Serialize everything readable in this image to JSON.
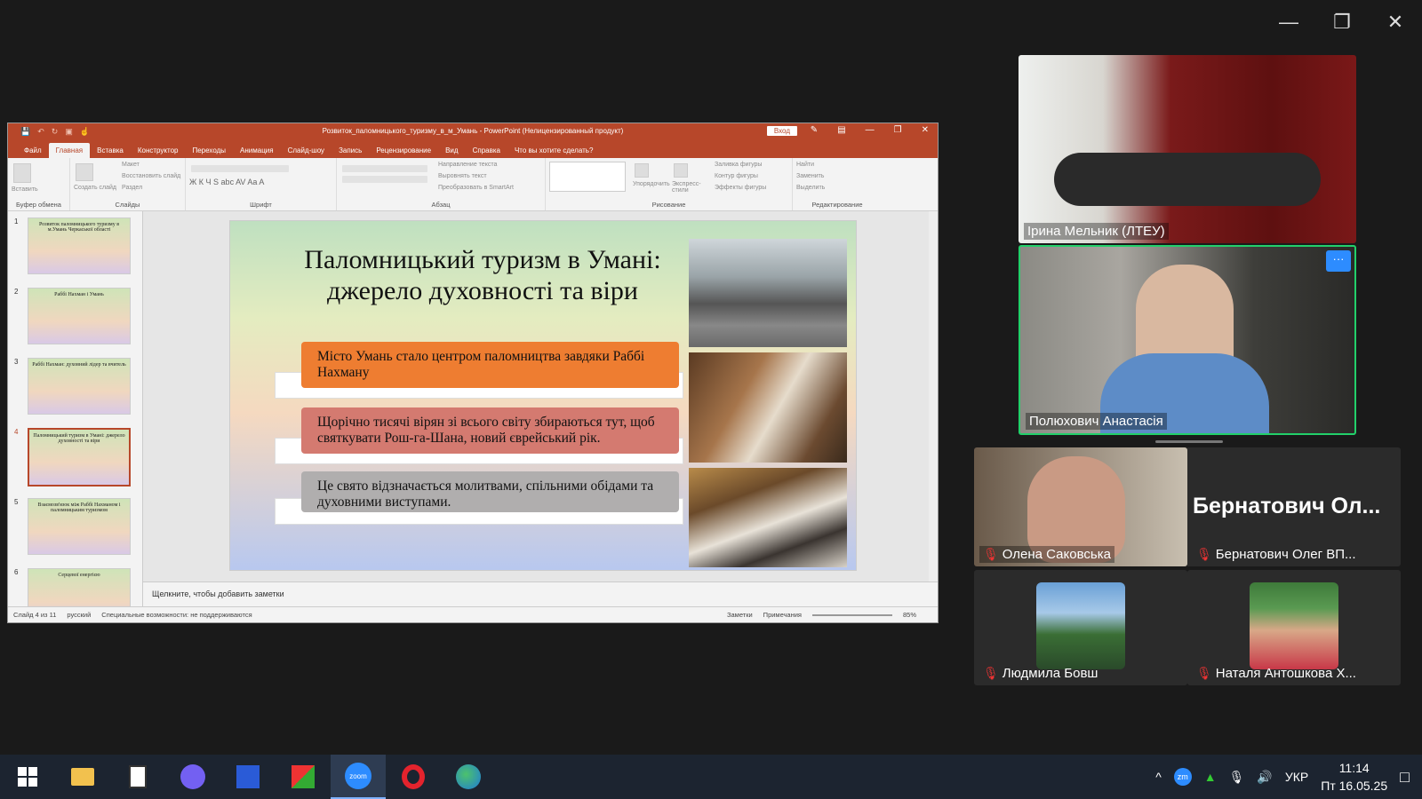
{
  "zoom_window": {
    "controls": [
      "minimize",
      "restore",
      "close"
    ]
  },
  "ppt": {
    "doc_title": "Розвиток_паломницького_туризму_в_м_Умань - PowerPoint (Нелицензированный продукт)",
    "signin": "Вход",
    "tabs": [
      "Файл",
      "Главная",
      "Вставка",
      "Конструктор",
      "Переходы",
      "Анимация",
      "Слайд-шоу",
      "Запись",
      "Рецензирование",
      "Вид",
      "Справка",
      "Что вы хотите сделать?"
    ],
    "ribbon_groups": [
      "Буфер обмена",
      "Слайды",
      "Шрифт",
      "Абзац",
      "Рисование",
      "Редактирование"
    ],
    "ribbon_items": {
      "paste": "Вставить",
      "create_slide": "Создать слайд",
      "layout": "Макет",
      "reset": "Восстановить слайд",
      "section": "Раздел",
      "text_dir": "Направление текста",
      "align_text": "Выровнять текст",
      "smartart": "Преобразовать в SmartArt",
      "arrange": "Упорядочить",
      "quick_styles": "Экспресс-стили",
      "fill": "Заливка фигуры",
      "outline": "Контур фигуры",
      "effects": "Эффекты фигуры",
      "find": "Найти",
      "replace": "Заменить",
      "select": "Выделить"
    },
    "thumbnails": [
      {
        "num": "1",
        "title": "Розвиток паломницького туризму в м.Умань Черкаської області"
      },
      {
        "num": "2",
        "title": "Раббі Нахман і Умань"
      },
      {
        "num": "3",
        "title": "Раббі Нахман: духовний лідер та вчитель"
      },
      {
        "num": "4",
        "title": "Паломницький туризм в Умані: джерело духовності та віри"
      },
      {
        "num": "5",
        "title": "Взаємозв'язок між Раббі Нахманом і паломницьким туризмом"
      },
      {
        "num": "6",
        "title": "Серцевої енергією"
      }
    ],
    "slide": {
      "title_line1": "Паломницький туризм в Умані:",
      "title_line2": "джерело духовності та віри",
      "bullets": [
        "Місто Умань стало центром паломництва завдяки Раббі Нахману",
        "Щорічно тисячі вірян зі всього світу збираються тут, щоб святкувати Рош-га-Шана, новий єврейський рік.",
        "Це свято відзначається молитвами, спільними обідами та духовними виступами."
      ]
    },
    "notes_placeholder": "Щелкните, чтобы добавить заметки",
    "status": {
      "slide_info": "Слайд 4 из 11",
      "language": "русский",
      "accessibility": "Специальные возможности: не поддерживаются",
      "notes": "Заметки",
      "comments": "Примечания",
      "zoom": "85%"
    }
  },
  "participants": {
    "top": "Ірина Мельник (ЛТЕУ)",
    "active": "Полюхович Анастасія",
    "p3": "Олена Саковська",
    "p4_big": "Бернатович Ол...",
    "p4": "Бернатович Олег ВП...",
    "p5": "Людмила Бовш",
    "p6": "Наталя Антошкова Х..."
  },
  "taskbar": {
    "apps": [
      "start",
      "explorer",
      "calculator",
      "viber",
      "save",
      "app",
      "zoom",
      "opera",
      "edge"
    ],
    "zoom_label": "zoom",
    "lang": "УКР",
    "time": "11:14",
    "date": "Пт 16.05.25"
  }
}
